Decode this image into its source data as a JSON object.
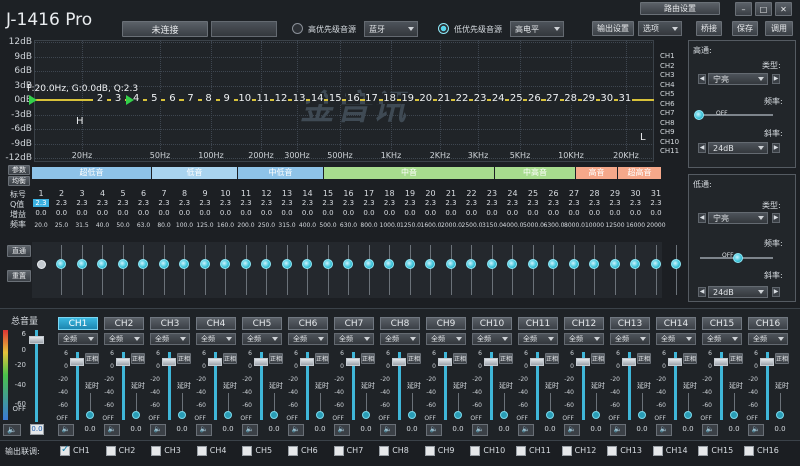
{
  "app": {
    "title": "J-1416 Pro"
  },
  "toolbar": {
    "routing_button": "路由设置",
    "connection_status": "未连接",
    "device_select": "",
    "high_priority_label": "高优先级音源",
    "high_priority_value": "蓝牙",
    "low_priority_label": "低优先级音源",
    "low_priority_value": "高电平",
    "output_settings": "输出设置",
    "options": "选项",
    "bridge": "桥接",
    "save": "保存",
    "recall": "调用"
  },
  "eq_graph": {
    "y_labels": [
      "12dB",
      "9dB",
      "6dB",
      "3dB",
      "0dB",
      "-3dB",
      "-6dB",
      "-9dB",
      "-12dB"
    ],
    "x_labels": [
      "20Hz",
      "50Hz",
      "100Hz",
      "200Hz",
      "300Hz",
      "500Hz",
      "1KHz",
      "2KHz",
      "3KHz",
      "5KHz",
      "10KHz",
      "20KHz"
    ],
    "readout": "F:20.0Hz, G:0.0dB, Q:2.3",
    "point_numbers": [
      "1",
      "2",
      "3",
      "4",
      "5",
      "6",
      "7",
      "8",
      "9",
      "10",
      "11",
      "12",
      "13",
      "14",
      "15",
      "16",
      "17",
      "18",
      "19",
      "20",
      "21",
      "22",
      "23",
      "24",
      "25",
      "26",
      "27",
      "28",
      "29",
      "30",
      "31"
    ],
    "marker_H": "H",
    "marker_L": "L",
    "watermark": "金音讯",
    "ch_list": [
      "CH1",
      "CH2",
      "CH3",
      "CH4",
      "CH5",
      "CH6",
      "CH7",
      "CH8",
      "CH9",
      "CH10",
      "CH11"
    ]
  },
  "band_bar": {
    "bands": [
      {
        "label": "超低音",
        "color": "#8ec3e8"
      },
      {
        "label": "低音",
        "color": "#a9d4ef"
      },
      {
        "label": "中低音",
        "color": "#8ec3e8"
      },
      {
        "label": "中音",
        "color": "#a7dc8e"
      },
      {
        "label": "中高音",
        "color": "#a7dc8e"
      },
      {
        "label": "高音",
        "color": "#f6a88a"
      },
      {
        "label": "超高音",
        "color": "#f6a88a"
      }
    ]
  },
  "eq_table": {
    "buttons": {
      "params": "参数",
      "equalize": "均衡",
      "direct": "直通",
      "reset": "重置"
    },
    "row_labels": [
      "标号",
      "Q值",
      "增益",
      "频率"
    ],
    "numbers": [
      "1",
      "2",
      "3",
      "4",
      "5",
      "6",
      "7",
      "8",
      "9",
      "10",
      "11",
      "12",
      "13",
      "14",
      "15",
      "16",
      "17",
      "18",
      "19",
      "20",
      "21",
      "22",
      "23",
      "24",
      "25",
      "26",
      "27",
      "28",
      "29",
      "30",
      "31"
    ],
    "q_value": "2.3",
    "gain_value": "0.0",
    "freqs": [
      "20.0",
      "25.0",
      "31.5",
      "40.0",
      "50.0",
      "63.0",
      "80.0",
      "100.0",
      "125.0",
      "160.0",
      "200.0",
      "250.0",
      "315.0",
      "400.0",
      "500.0",
      "630.0",
      "800.0",
      "1000.0",
      "1250.0",
      "1600.0",
      "2000.0",
      "2500.0",
      "3150.0",
      "4000.0",
      "5000.0",
      "6300.0",
      "8000.0",
      "10000",
      "12500",
      "16000",
      "20000"
    ]
  },
  "right_panel": {
    "high_pass": {
      "title": "高通:",
      "type_label": "类型:",
      "type_value": "宁亮",
      "freq_label": "频率:",
      "freq_value": "OFF",
      "slope_label": "斜率:",
      "slope_value": "24dB"
    },
    "low_pass": {
      "title": "低通:",
      "type_label": "类型:",
      "type_value": "宁亮",
      "freq_label": "频率:",
      "freq_value": "OFF",
      "slope_label": "斜率:",
      "slope_value": "24dB"
    }
  },
  "master": {
    "title": "总音量",
    "scale": [
      "6",
      "0",
      "-20",
      "-40",
      "-60",
      "OFF"
    ],
    "value": "0.0"
  },
  "channels": {
    "tabs": [
      "CH1",
      "CH2",
      "CH3",
      "CH4",
      "CH5",
      "CH6",
      "CH7",
      "CH8",
      "CH9",
      "CH10",
      "CH11",
      "CH12",
      "CH13",
      "CH14",
      "CH15",
      "CH16"
    ],
    "mode": "全频",
    "phase": "正相",
    "delay": "延时",
    "scale": [
      "6",
      "0",
      "-20",
      "-40",
      "-60",
      "OFF"
    ],
    "value": "0.0"
  },
  "output_link": {
    "label": "输出联调:",
    "channels": [
      "CH1",
      "CH2",
      "CH3",
      "CH4",
      "CH5",
      "CH6",
      "CH7",
      "CH8",
      "CH9",
      "CH10",
      "CH11",
      "CH12",
      "CH13",
      "CH14",
      "CH15",
      "CH16"
    ],
    "checked_index": 0
  }
}
